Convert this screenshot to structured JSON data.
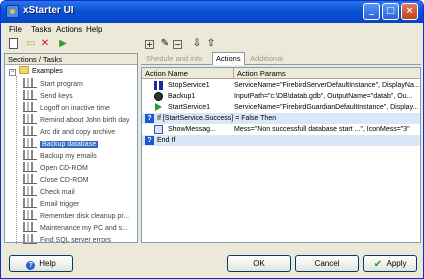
{
  "window": {
    "title": "xStarter UI"
  },
  "menu": [
    "File",
    "Tasks",
    "Actions",
    "Help"
  ],
  "toolbar": {
    "icons": [
      "new-icon",
      "open-icon",
      "delete-icon",
      "run-icon"
    ]
  },
  "left_panel": {
    "header": "Sections / Tasks",
    "root": "Examples",
    "tasks": [
      "Start program",
      "Send keys",
      "Logoff on inactive time",
      "Remind about John birth day",
      "Arc dir and copy archive",
      "Backup database",
      "Backup my emails",
      "Open CD-ROM",
      "Close CD-ROM",
      "Check mail",
      "Email trigger",
      "Remember disk cleanup pr...",
      "Maintenance my PC and s...",
      "Find SQL server errors"
    ],
    "selected_index": 5
  },
  "right_panel": {
    "toolbar_icons": [
      "add-icon",
      "edit-icon",
      "remove-icon",
      "move-down-icon",
      "move-up-icon"
    ],
    "tabs": [
      "Shedule and info",
      "Actions",
      "Additional"
    ],
    "active_tab": 1,
    "columns": [
      "Action Name",
      "Action Params"
    ],
    "rows": [
      {
        "name": "StopService1",
        "params": "ServiceName=\"FirebirdServerDefaultInstance\", DisplayNa...",
        "icon": "stop-icon",
        "kind": "action"
      },
      {
        "name": "Backup1",
        "params": "InputPath=\"c:\\DB\\datab.gdb\", OutputName=\"datab\", Ou...",
        "icon": "backup-icon",
        "kind": "action"
      },
      {
        "name": "StartService1",
        "params": "ServiceName=\"FirebirdGuardianDefaultInstance\", Display...",
        "icon": "start-icon",
        "kind": "action"
      },
      {
        "name": "If [StartService.Success] = False Then",
        "params": "",
        "icon": "condition-icon",
        "kind": "cond"
      },
      {
        "name": "ShowMessag...",
        "params": "Mess=\"Non successfull database start ...\", IconMess=\"3\"",
        "icon": "message-icon",
        "kind": "nested"
      },
      {
        "name": "End If",
        "params": "",
        "icon": "condition-icon",
        "kind": "cond"
      }
    ]
  },
  "buttons": {
    "help": "Help",
    "ok": "OK",
    "cancel": "Cancel",
    "apply": "Apply"
  }
}
